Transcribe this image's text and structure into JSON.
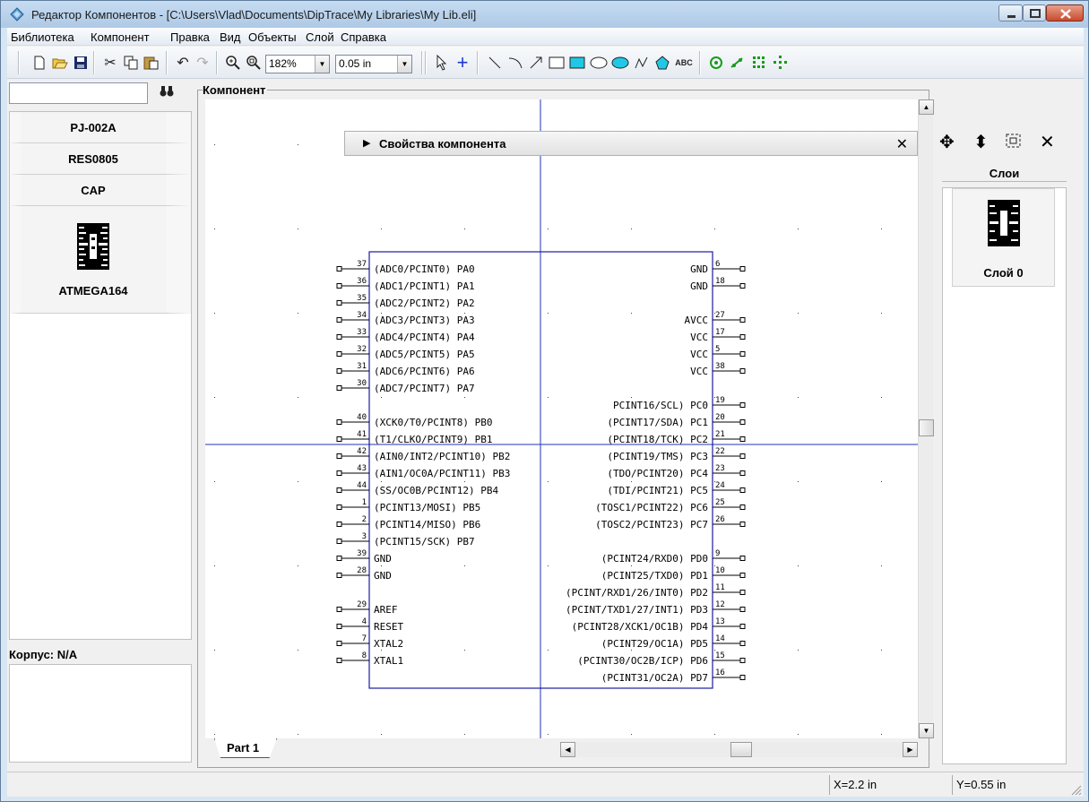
{
  "window": {
    "title": "Редактор Компонентов - [C:\\Users\\Vlad\\Documents\\DipTrace\\My Libraries\\My Lib.eli]"
  },
  "menu": [
    "Библиотека",
    "Компонент",
    "Правка",
    "Вид",
    "Объекты",
    "Слой",
    "Справка"
  ],
  "toolbar": {
    "zoom": "182%",
    "grid": "0.05 in",
    "icons": [
      "new-icon",
      "open-icon",
      "save-icon",
      "cut-icon",
      "copy-icon",
      "paste-icon",
      "undo-icon",
      "redo-icon",
      "zoom-in-icon",
      "zoom-fit-icon",
      "pointer-icon",
      "crosshair-icon",
      "line-icon",
      "arc-icon",
      "arrow-icon",
      "rectangle-icon",
      "filled-rectangle-icon",
      "ellipse-icon",
      "filled-ellipse-icon",
      "polyline-icon",
      "polygon-icon",
      "text-icon",
      "pin-icon",
      "pin-group-icon",
      "pin-matrix-icon",
      "pin-arrange-icon"
    ]
  },
  "left_panel": {
    "search_placeholder": "",
    "components": [
      "PJ-002A",
      "RES0805",
      "CAP",
      "ATMEGA164"
    ],
    "package_label": "Корпус: N/A"
  },
  "canvas": {
    "frame_label": "Компонент",
    "properties_title": "Свойства компонента",
    "tab": "Part 1",
    "left_pins": [
      {
        "num": "37",
        "name": "(ADC0/PCINT0) PA0"
      },
      {
        "num": "36",
        "name": "(ADC1/PCINT1) PA1"
      },
      {
        "num": "35",
        "name": "(ADC2/PCINT2) PA2"
      },
      {
        "num": "34",
        "name": "(ADC3/PCINT3) PA3"
      },
      {
        "num": "33",
        "name": "(ADC4/PCINT4) PA4"
      },
      {
        "num": "32",
        "name": "(ADC5/PCINT5) PA5"
      },
      {
        "num": "31",
        "name": "(ADC6/PCINT6) PA6"
      },
      {
        "num": "30",
        "name": "(ADC7/PCINT7) PA7"
      },
      null,
      {
        "num": "40",
        "name": "(XCK0/T0/PCINT8) PB0"
      },
      {
        "num": "41",
        "name": "(T1/CLKO/PCINT9) PB1"
      },
      {
        "num": "42",
        "name": "(AIN0/INT2/PCINT10) PB2"
      },
      {
        "num": "43",
        "name": "(AIN1/OC0A/PCINT11) PB3"
      },
      {
        "num": "44",
        "name": "(SS/OC0B/PCINT12) PB4"
      },
      {
        "num": "1",
        "name": "(PCINT13/MOSI) PB5"
      },
      {
        "num": "2",
        "name": "(PCINT14/MISO) PB6"
      },
      {
        "num": "3",
        "name": "(PCINT15/SCK) PB7"
      },
      {
        "num": "39",
        "name": "GND"
      },
      {
        "num": "28",
        "name": "GND"
      },
      null,
      {
        "num": "29",
        "name": "AREF"
      },
      {
        "num": "4",
        "name": "RESET"
      },
      {
        "num": "7",
        "name": "XTAL2"
      },
      {
        "num": "8",
        "name": "XTAL1"
      }
    ],
    "right_pins": [
      {
        "num": "6",
        "name": "GND"
      },
      {
        "num": "18",
        "name": "GND"
      },
      null,
      {
        "num": "27",
        "name": "AVCC"
      },
      {
        "num": "17",
        "name": "VCC"
      },
      {
        "num": "5",
        "name": "VCC"
      },
      {
        "num": "38",
        "name": "VCC"
      },
      null,
      {
        "num": "19",
        "name": "PCINT16/SCL) PC0"
      },
      {
        "num": "20",
        "name": "(PCINT17/SDA) PC1"
      },
      {
        "num": "21",
        "name": "(PCINT18/TCK) PC2"
      },
      {
        "num": "22",
        "name": "(PCINT19/TMS) PC3"
      },
      {
        "num": "23",
        "name": "(TDO/PCINT20) PC4"
      },
      {
        "num": "24",
        "name": "(TDI/PCINT21) PC5"
      },
      {
        "num": "25",
        "name": "(TOSC1/PCINT22) PC6"
      },
      {
        "num": "26",
        "name": "(TOSC2/PCINT23) PC7"
      },
      null,
      {
        "num": "9",
        "name": "(PCINT24/RXD0) PD0"
      },
      {
        "num": "10",
        "name": "(PCINT25/TXD0) PD1"
      },
      {
        "num": "11",
        "name": "(PCINT/RXD1/26/INT0) PD2"
      },
      {
        "num": "12",
        "name": "(PCINT/TXD1/27/INT1) PD3"
      },
      {
        "num": "13",
        "name": "(PCINT28/XCK1/OC1B) PD4"
      },
      {
        "num": "14",
        "name": "(PCINT29/OC1A) PD5"
      },
      {
        "num": "15",
        "name": "(PCINT30/OC2B/ICP) PD6"
      },
      {
        "num": "16",
        "name": "(PCINT31/OC2A) PD7"
      }
    ]
  },
  "right_panel": {
    "layers_title": "Слои",
    "layer_name": "Слой 0"
  },
  "status": {
    "x": "X=2.2 in",
    "y": "Y=0.55 in"
  },
  "colors": {
    "schematic_line": "#1a1aa0",
    "crosshair": "#2233bb",
    "pin_text": "#000000"
  }
}
